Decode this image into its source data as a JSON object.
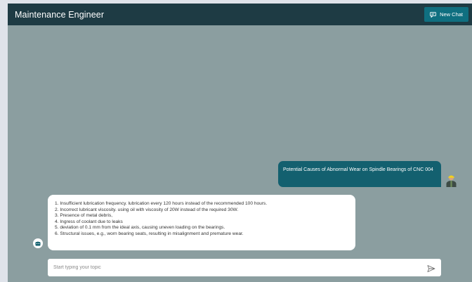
{
  "header": {
    "title": "Maintenance Engineer",
    "new_chat_label": "New Chat",
    "new_chat_icon": "chat-icon"
  },
  "conversation": {
    "user_message": "Potential Causes of Abnormal Wear on Spindle Bearings of CNC 004",
    "bot_items": [
      "1. Insufficient lubrication frequency. lubrication every 120 hours  instead of the recommended 100 hours.",
      "2. Incorrect lubricant viscosity. using oil with viscosity of 20W instead of the required 30W.",
      "3. Presence of metal debris,",
      "4. Ingress of coolant due to leaks",
      "5. deviation of 0.1 mm from the ideal axis, causing uneven loading on the bearings.",
      "6. Structural issues, e.g., worn bearing seats, resulting in misalignment and premature wear."
    ]
  },
  "composer": {
    "placeholder": "Start typing your topic",
    "value": "",
    "send_icon": "send-icon"
  },
  "colors": {
    "header_bg": "#1e3b44",
    "canvas_bg": "#8b9ea0",
    "accent": "#0f6f80",
    "user_bubble": "#13606f"
  }
}
